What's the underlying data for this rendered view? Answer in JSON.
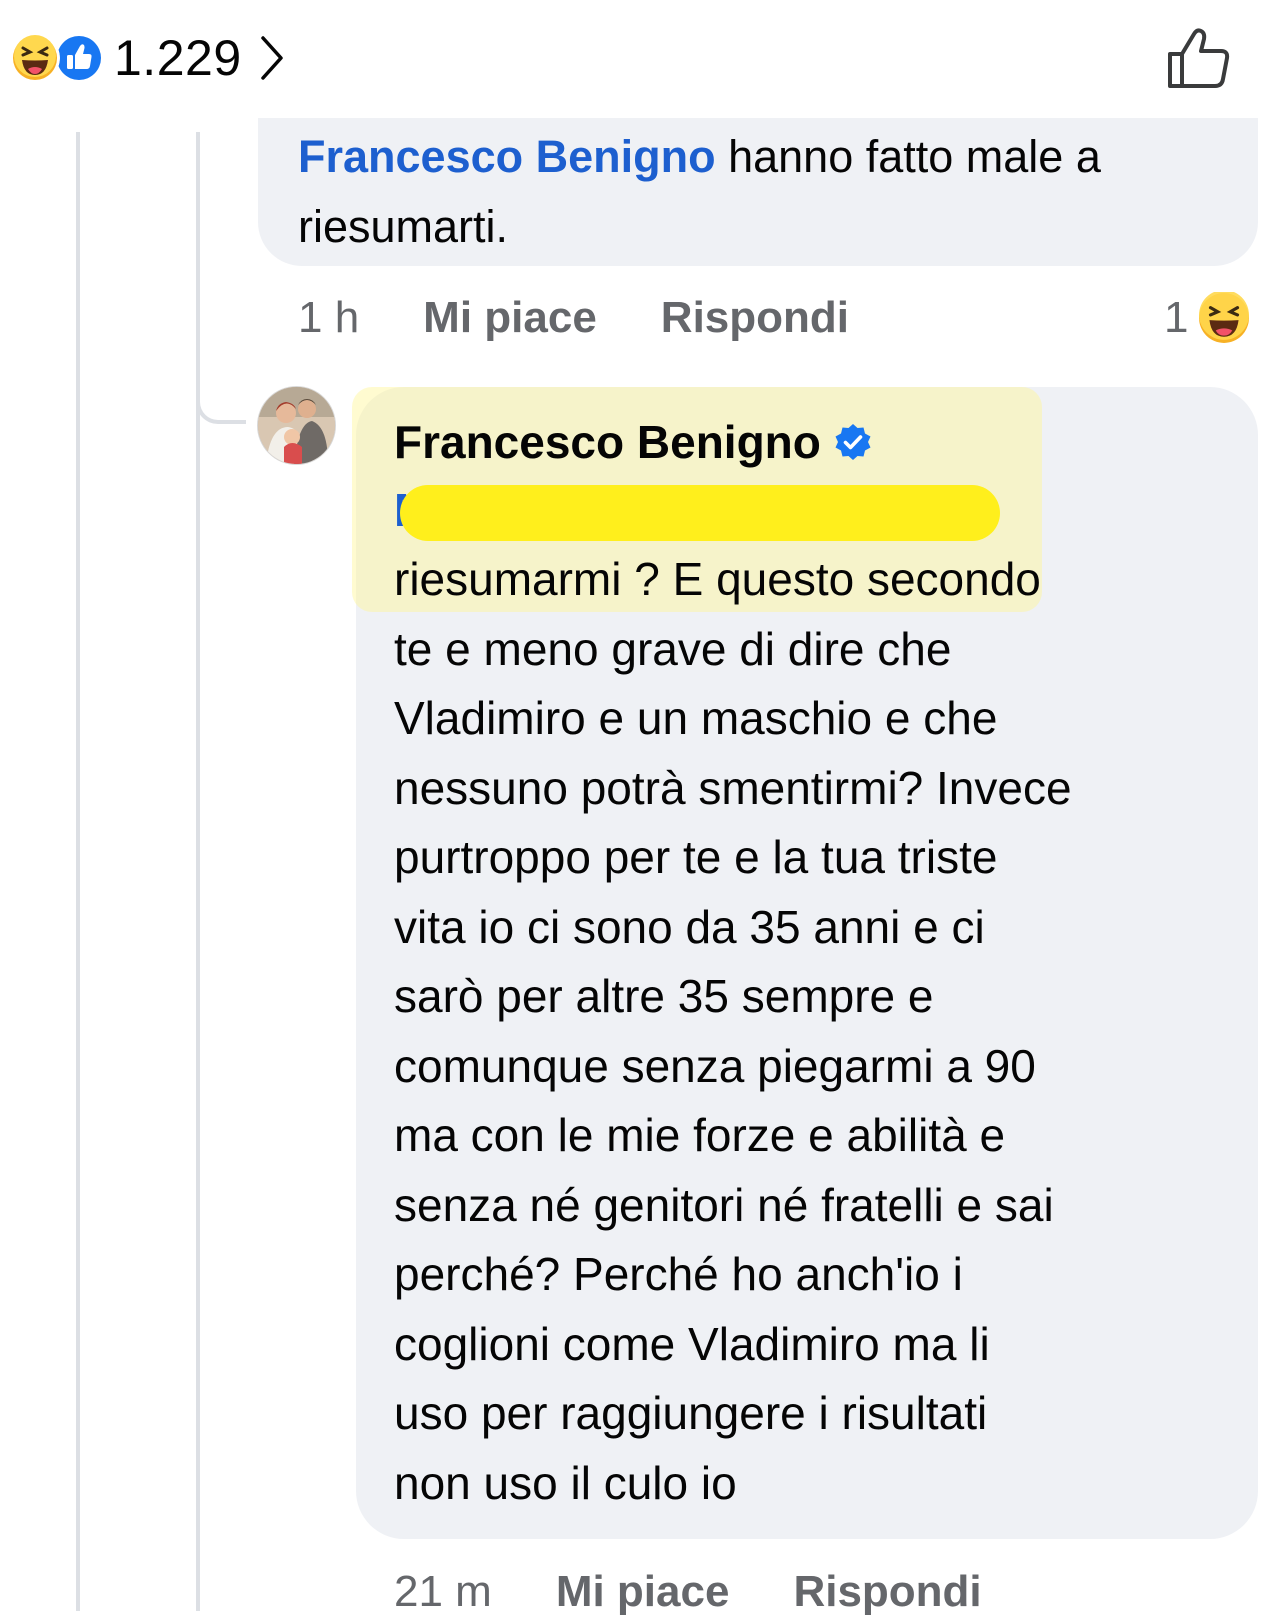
{
  "reactions_bar": {
    "count": "1.229",
    "icons": [
      "haha-emoji-icon",
      "like-reaction-icon"
    ]
  },
  "previous_comment": {
    "mention": "Francesco Benigno",
    "text": " hanno fatto male a riesumarti.",
    "time": "1 h",
    "like_label": "Mi piace",
    "reply_label": "Rispondi",
    "reaction_count": "1"
  },
  "reply_comment": {
    "author": "Francesco Benigno",
    "mention_visible": "M",
    "text": "riesumarmi ? E questo secondo\nte e meno grave di dire che\nVladimiro e un maschio e che\nnessuno potrà smentirmi? Invece\npurtroppo per te e la tua triste\nvita io ci sono da 35 anni e ci\nsarò per altre 35 sempre e\ncomunque senza piegarmi a 90\nma con le mie forze e abilità e\nsenza né genitori né fratelli e sai\nperché? Perché ho anch'io i\ncoglioni come Vladimiro ma li\nuso per raggiungere i risultati\nnon uso il culo io",
    "time": "21 m",
    "like_label": "Mi piace",
    "reply_label": "Rispondi"
  },
  "colors": {
    "bubble": "#eff1f5",
    "mention": "#1d5fcf",
    "meta_text": "#65676b",
    "verified": "#1877f2",
    "redaction": "#ffef1c"
  }
}
